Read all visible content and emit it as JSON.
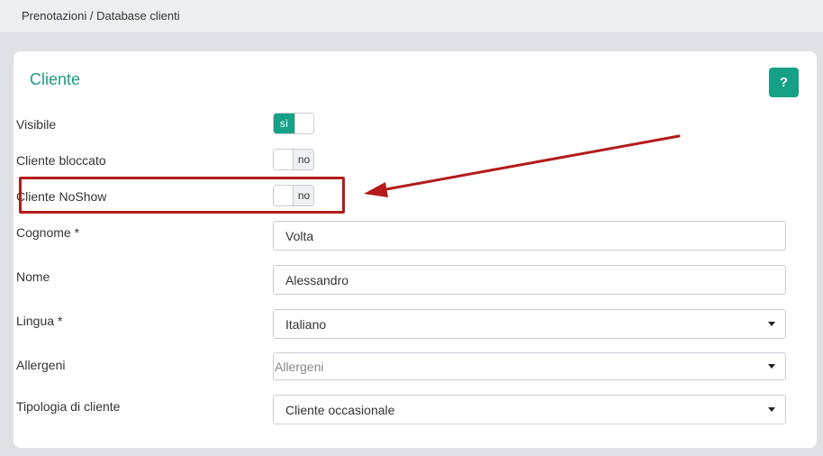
{
  "breadcrumb": "Prenotazioni / Database clienti",
  "card": {
    "title": "Cliente",
    "help_label": "?"
  },
  "fields": {
    "visibile": {
      "label": "Visibile",
      "state": "sì"
    },
    "cliente_bloccato": {
      "label": "Cliente bloccato",
      "state": "no"
    },
    "cliente_noshow": {
      "label": "Cliente NoShow",
      "state": "no"
    },
    "cognome": {
      "label": "Cognome *",
      "value": "Volta"
    },
    "nome": {
      "label": "Nome",
      "value": "Alessandro"
    },
    "lingua": {
      "label": "Lingua *",
      "value": "Italiano"
    },
    "allergeni": {
      "label": "Allergeni",
      "placeholder": "Allergeni"
    },
    "tipologia": {
      "label": "Tipologia di cliente",
      "value": "Cliente occasionale"
    }
  },
  "colors": {
    "accent": "#16a085",
    "annotation": "#b31b1b"
  },
  "icons": {
    "dropdown": "chevron-down-icon",
    "annotation_arrow": "arrow-icon"
  }
}
